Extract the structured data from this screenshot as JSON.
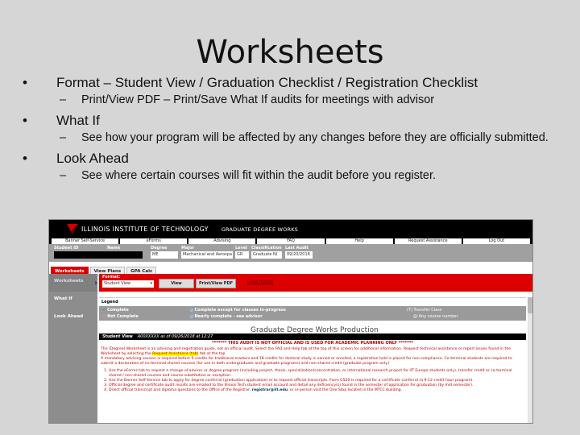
{
  "slide": {
    "title": "Worksheets",
    "bullets": [
      {
        "text": "Format – Student View / Graduation Checklist / Registration Checklist",
        "sub": [
          "Print/View PDF – Print/Save What If audits for meetings with advisor"
        ]
      },
      {
        "text": "What If",
        "sub": [
          "See how your program will be affected by any changes before they are officially submitted."
        ]
      },
      {
        "text": "Look Ahead",
        "sub": [
          "See where certain courses will fit within the audit before you register."
        ]
      }
    ],
    "bullet_glyph": "•",
    "dash_glyph": "–"
  },
  "app": {
    "institution": "ILLINOIS INSTITUTE OF TECHNOLOGY",
    "product": "GRADUATE DEGREE WORKS",
    "nav": [
      "Banner Self-Service",
      "eForms",
      "Advising",
      "FAQ",
      "Help",
      "Request Assistance",
      "Log Out"
    ],
    "student": {
      "labels": {
        "id": "Student ID",
        "name": "Name",
        "degree": "Degree",
        "major": "Major",
        "level": "Level",
        "classification": "Classification",
        "last_audit": "Last Audit"
      },
      "degree": "ME",
      "major": "Mechanical and Aerospa",
      "level": "GR",
      "classification": "Graduate N(",
      "last_audit": "09/20/2018"
    },
    "tabs": [
      "Worksheets",
      "View Plans",
      "GPA Calc"
    ],
    "sidebar": [
      "Worksheets",
      "What If",
      "Look Ahead"
    ],
    "format": {
      "label": "Format:",
      "selected": "Student View",
      "view_button": "View",
      "pdf_button": "Print/View PDF",
      "history_link": "Class History"
    },
    "legend": {
      "title": "Legend",
      "items": [
        "Complete",
        "Not Complete",
        "Complete except for classes in-progress",
        "Nearly complete - see advisor",
        "(T) Transfer Class",
        "@ Any course number"
      ]
    },
    "production_title": "Graduate Degree Works Production",
    "student_view": {
      "label": "Student View",
      "info": "A00XXXXX as of 09/26/2018 at 12:27"
    },
    "warning": "******* THIS AUDIT IS NOT OFFICIAL AND IS USED FOR ACADEMIC PLANNING ONLY *******",
    "intro": {
      "p1_before": "The (Degree) Worksheet is an advising and registration guide, not an official audit. Select the FAQ and Help tab at the top of this screen for additional information. Request technical assistance or report issues found in the Worksheet by selecting the ",
      "p1_highlight": "Request Assistance (tab)",
      "p1_after": " tab at the top.",
      "p2": "A mandatory advising session is required before 9 credits for traditional masters and 18 credits for doctoral study is earned or enrolled, a registration hold is placed for non-compliance. Co-terminal students are required to submit a declaration of co-terminal shared courses (for use in both undergraduate and graduate programs) and non-shared credit (graduate program only.)"
    },
    "steps": [
      "Use the eForms tab to request a change of advisor or degree program (including project, thesis, specialization/concentration, or international research project for IIT Europe students only), transfer credit or co-terminal shared / non-shared courses and course substitution or exception.",
      "Use the Banner Self-Service tab to apply for degree conferral (graduation application) or to request official transcripts. Form G520 is required for a certificate conferral (a 9-12 credit hour program).",
      "Official degree and certificate audit results are emailed to the Illinois Tech student email account and detail any deficiency(s) found in the semester of application for graduation (by mid semester).",
      "Direct official transcript and diploma questions to the Office of the Registrar, "
    ],
    "registrar_email": "registrar@iit.edu",
    "step4_after": ", or in-person visit the One Stop located in the MTCC building."
  },
  "colors": {
    "brand_red": "#dd0000",
    "header_black": "#000000",
    "text_red": "#bb0000",
    "slide_bg": "#d6d6d6"
  }
}
